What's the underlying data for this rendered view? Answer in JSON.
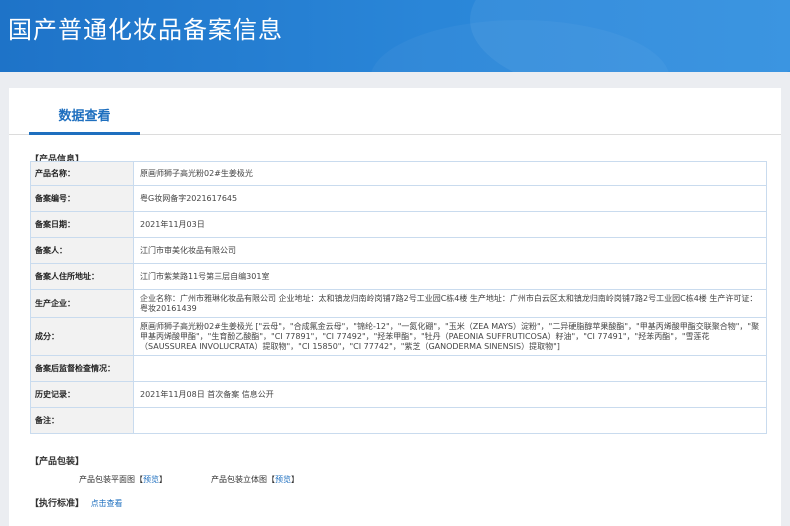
{
  "header": {
    "title": "国产普通化妆品备案信息"
  },
  "tabs": [
    {
      "label": "数据查看"
    }
  ],
  "product_section": {
    "label": "【产品信息】",
    "rows": [
      {
        "key": "产品名称：",
        "value": "原画师狮子高光粉02#生姜极光"
      },
      {
        "key": "备案编号：",
        "value": "粤G妆网备字2021617645"
      },
      {
        "key": "备案日期：",
        "value": "2021年11月03日"
      },
      {
        "key": "备案人：",
        "value": "江门市审美化妆品有限公司"
      },
      {
        "key": "备案人住所地址：",
        "value": "江门市紫莱路11号第三层自编301室"
      },
      {
        "key": "生产企业：",
        "value": "企业名称：广州市雅琳化妆品有限公司 企业地址：太和镇龙归南岭岗铺7路2号工业园C栋4楼 生产地址：广州市白云区太和镇龙归南岭岗铺7路2号工业园C栋4楼 生产许可证：粤妆20161439"
      },
      {
        "key": "成分：",
        "value": "原画师狮子高光粉02#生姜极光 [\"云母\"，\"合成氟金云母\"，\"锦纶-12\"，\"一氮化硼\"，\"玉米（ZEA MAYS）淀粉\"，\"二异硬脂醇苹果酸酯\"，\"甲基丙烯酸甲酯交联聚合物\"，\"聚甲基丙烯酸甲酯\"，\"生育酚乙酸酯\"，\"CI 77891\"，\"CI 77492\"，\"羟苯甲酯\"，\"牡丹（PAEONIA SUFFRUTICOSA）籽油\"，\"CI 77491\"，\"羟苯丙酯\"，\"雪莲花（SAUSSUREA INVOLUCRATA）提取物\"，\"CI 15850\"，\"CI 77742\"，\"紫芝（GANODERMA SINENSIS）提取物\"]"
      },
      {
        "key": "备案后监督检查情况：",
        "value": ""
      },
      {
        "key": "历史记录：",
        "value": "2021年11月08日 首次备案 信息公开"
      },
      {
        "key": "备注：",
        "value": ""
      }
    ]
  },
  "packaging_section": {
    "label": "【产品包装】",
    "items": [
      {
        "label": "产品包装平面图",
        "bracket_open": "【",
        "link": "预览",
        "bracket_close": "】"
      },
      {
        "label": "产品包装立体图",
        "bracket_open": "【",
        "link": "预览",
        "bracket_close": "】"
      }
    ]
  },
  "standard_section": {
    "label": "【执行标准】",
    "link": "点击查看"
  },
  "colors": {
    "banner": "#2a86d8",
    "accent": "#1e6fbf",
    "key_bg": "#f2f2f2",
    "border": "#c9dbee"
  }
}
